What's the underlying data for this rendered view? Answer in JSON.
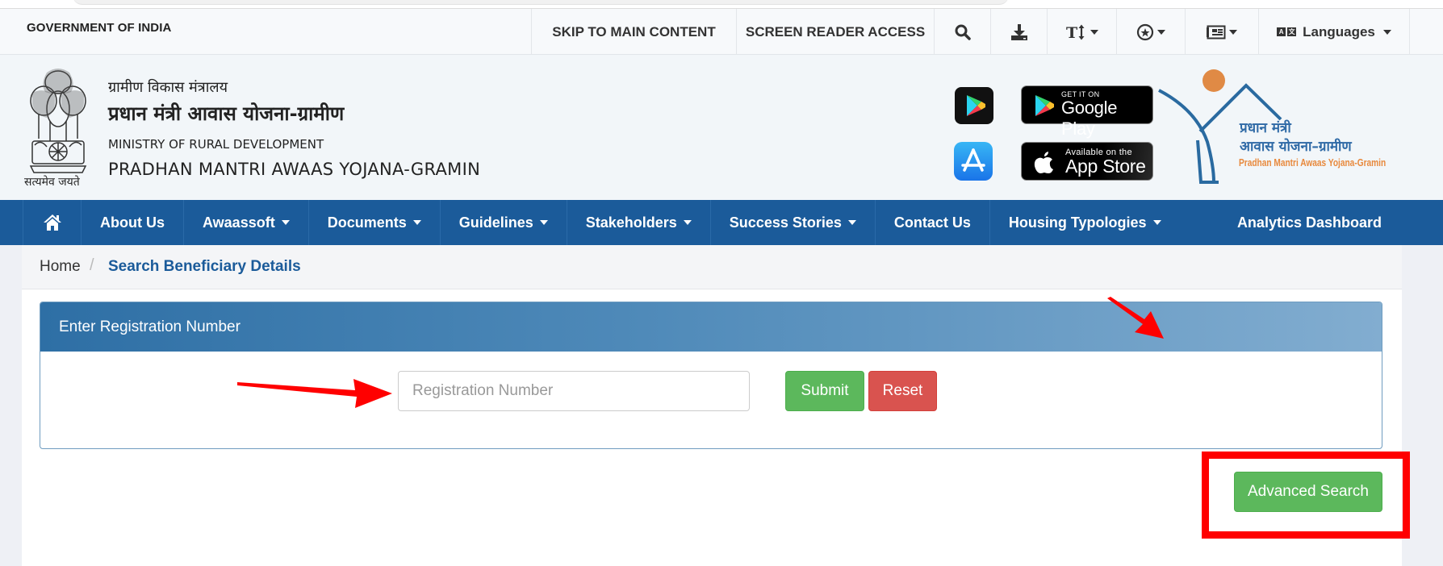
{
  "gov_bar": {
    "title": "GOVERNMENT OF INDIA",
    "utility": [
      {
        "label": "SKIP TO MAIN CONTENT",
        "icon": null
      },
      {
        "label": "SCREEN READER ACCESS",
        "icon": null
      },
      {
        "label": "",
        "icon": "search-icon"
      },
      {
        "label": "",
        "icon": "download-icon"
      },
      {
        "label": "",
        "icon": "text-size-icon"
      },
      {
        "label": "",
        "icon": "contrast-icon"
      },
      {
        "label": "",
        "icon": "sitemap-icon"
      },
      {
        "label": "Languages",
        "icon": "language-icon"
      }
    ]
  },
  "header": {
    "emblem_caption": "सत्यमेव जयते",
    "ministry_hindi": "ग्रामीण विकास मंत्रालय",
    "scheme_hindi": "प्रधान मंत्री आवास योजना-ग्रामीण",
    "ministry_english": "MINISTRY OF RURAL DEVELOPMENT",
    "scheme_english": "PRADHAN MANTRI AWAAS YOJANA-GRAMIN",
    "google_play": {
      "small": "GET IT ON",
      "big": "Google Play"
    },
    "app_store": {
      "small": "Available on the",
      "big": "App Store"
    },
    "logo": {
      "hindi_line1": "प्रधान मंत्री",
      "hindi_line2": "आवास योजना–ग्रामीण",
      "english": "Pradhan Mantri Awaas Yojana-Gramin"
    }
  },
  "nav": {
    "items": [
      {
        "label": "About Us",
        "dropdown": false
      },
      {
        "label": "Awaassoft",
        "dropdown": true
      },
      {
        "label": "Documents",
        "dropdown": true
      },
      {
        "label": "Guidelines",
        "dropdown": true
      },
      {
        "label": "Stakeholders",
        "dropdown": true
      },
      {
        "label": "Success Stories",
        "dropdown": true
      },
      {
        "label": "Contact Us",
        "dropdown": false
      },
      {
        "label": "Housing Typologies",
        "dropdown": true
      }
    ],
    "right_item": "Analytics Dashboard"
  },
  "breadcrumb": {
    "home": "Home",
    "separator": "/",
    "current": "Search Beneficiary Details"
  },
  "panel": {
    "title": "Enter Registration Number",
    "input_placeholder": "Registration Number",
    "input_value": "",
    "submit_label": "Submit",
    "reset_label": "Reset"
  },
  "advanced_search_label": "Advanced Search",
  "colors": {
    "nav_blue": "#1b5b9a",
    "success_green": "#5cb85c",
    "danger_red": "#d9534f",
    "annotation_red": "#ff0000"
  }
}
